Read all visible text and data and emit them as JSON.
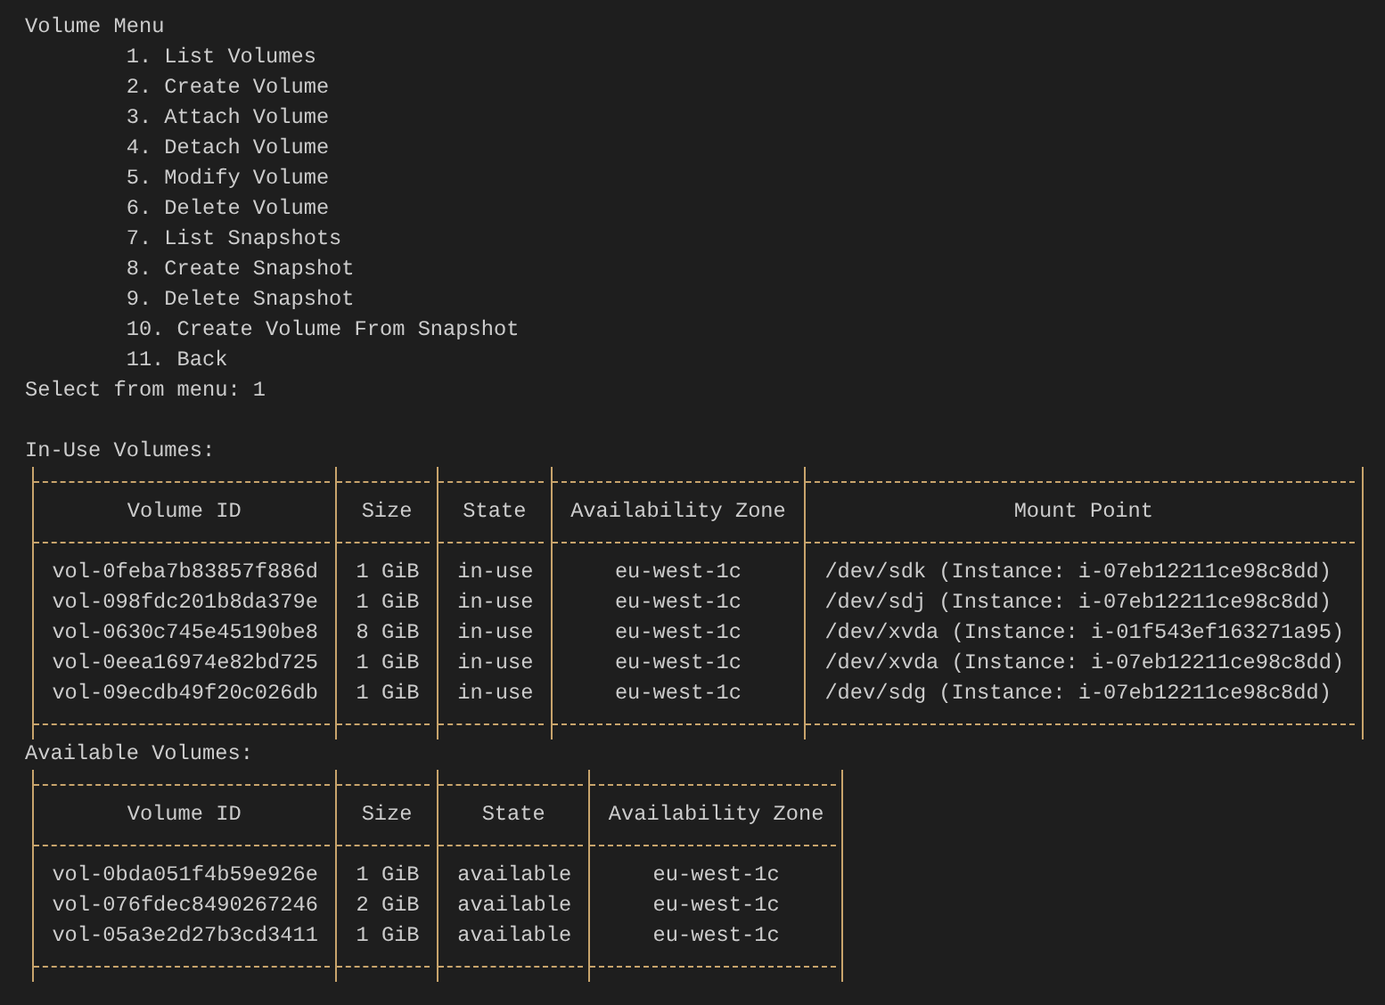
{
  "menu": {
    "title": "Volume Menu",
    "items": [
      "1. List Volumes",
      "2. Create Volume",
      "3. Attach Volume",
      "4. Detach Volume",
      "5. Modify Volume",
      "6. Delete Volume",
      "7. List Snapshots",
      "8. Create Snapshot",
      "9. Delete Snapshot",
      "10. Create Volume From Snapshot",
      "11. Back"
    ]
  },
  "prompt": {
    "label": "Select from menu:",
    "value": "1"
  },
  "tables": [
    {
      "title": "In-Use Volumes:",
      "columns": [
        "Volume ID",
        "Size",
        "State",
        "Availability Zone",
        "Mount Point"
      ],
      "rows": [
        [
          "vol-0feba7b83857f886d",
          "1 GiB",
          "in-use",
          "eu-west-1c",
          "/dev/sdk (Instance: i-07eb12211ce98c8dd)"
        ],
        [
          "vol-098fdc201b8da379e",
          "1 GiB",
          "in-use",
          "eu-west-1c",
          "/dev/sdj (Instance: i-07eb12211ce98c8dd)"
        ],
        [
          "vol-0630c745e45190be8",
          "8 GiB",
          "in-use",
          "eu-west-1c",
          "/dev/xvda (Instance: i-01f543ef163271a95)"
        ],
        [
          "vol-0eea16974e82bd725",
          "1 GiB",
          "in-use",
          "eu-west-1c",
          "/dev/xvda (Instance: i-07eb12211ce98c8dd)"
        ],
        [
          "vol-09ecdb49f20c026db",
          "1 GiB",
          "in-use",
          "eu-west-1c",
          "/dev/sdg (Instance: i-07eb12211ce98c8dd)"
        ]
      ]
    },
    {
      "title": "Available Volumes:",
      "columns": [
        "Volume ID",
        "Size",
        "State",
        "Availability Zone"
      ],
      "rows": [
        [
          "vol-0bda051f4b59e926e",
          "1 GiB",
          "available",
          "eu-west-1c"
        ],
        [
          "vol-076fdec8490267246",
          "2 GiB",
          "available",
          "eu-west-1c"
        ],
        [
          "vol-05a3e2d27b3cd3411",
          "1 GiB",
          "available",
          "eu-west-1c"
        ]
      ]
    }
  ]
}
